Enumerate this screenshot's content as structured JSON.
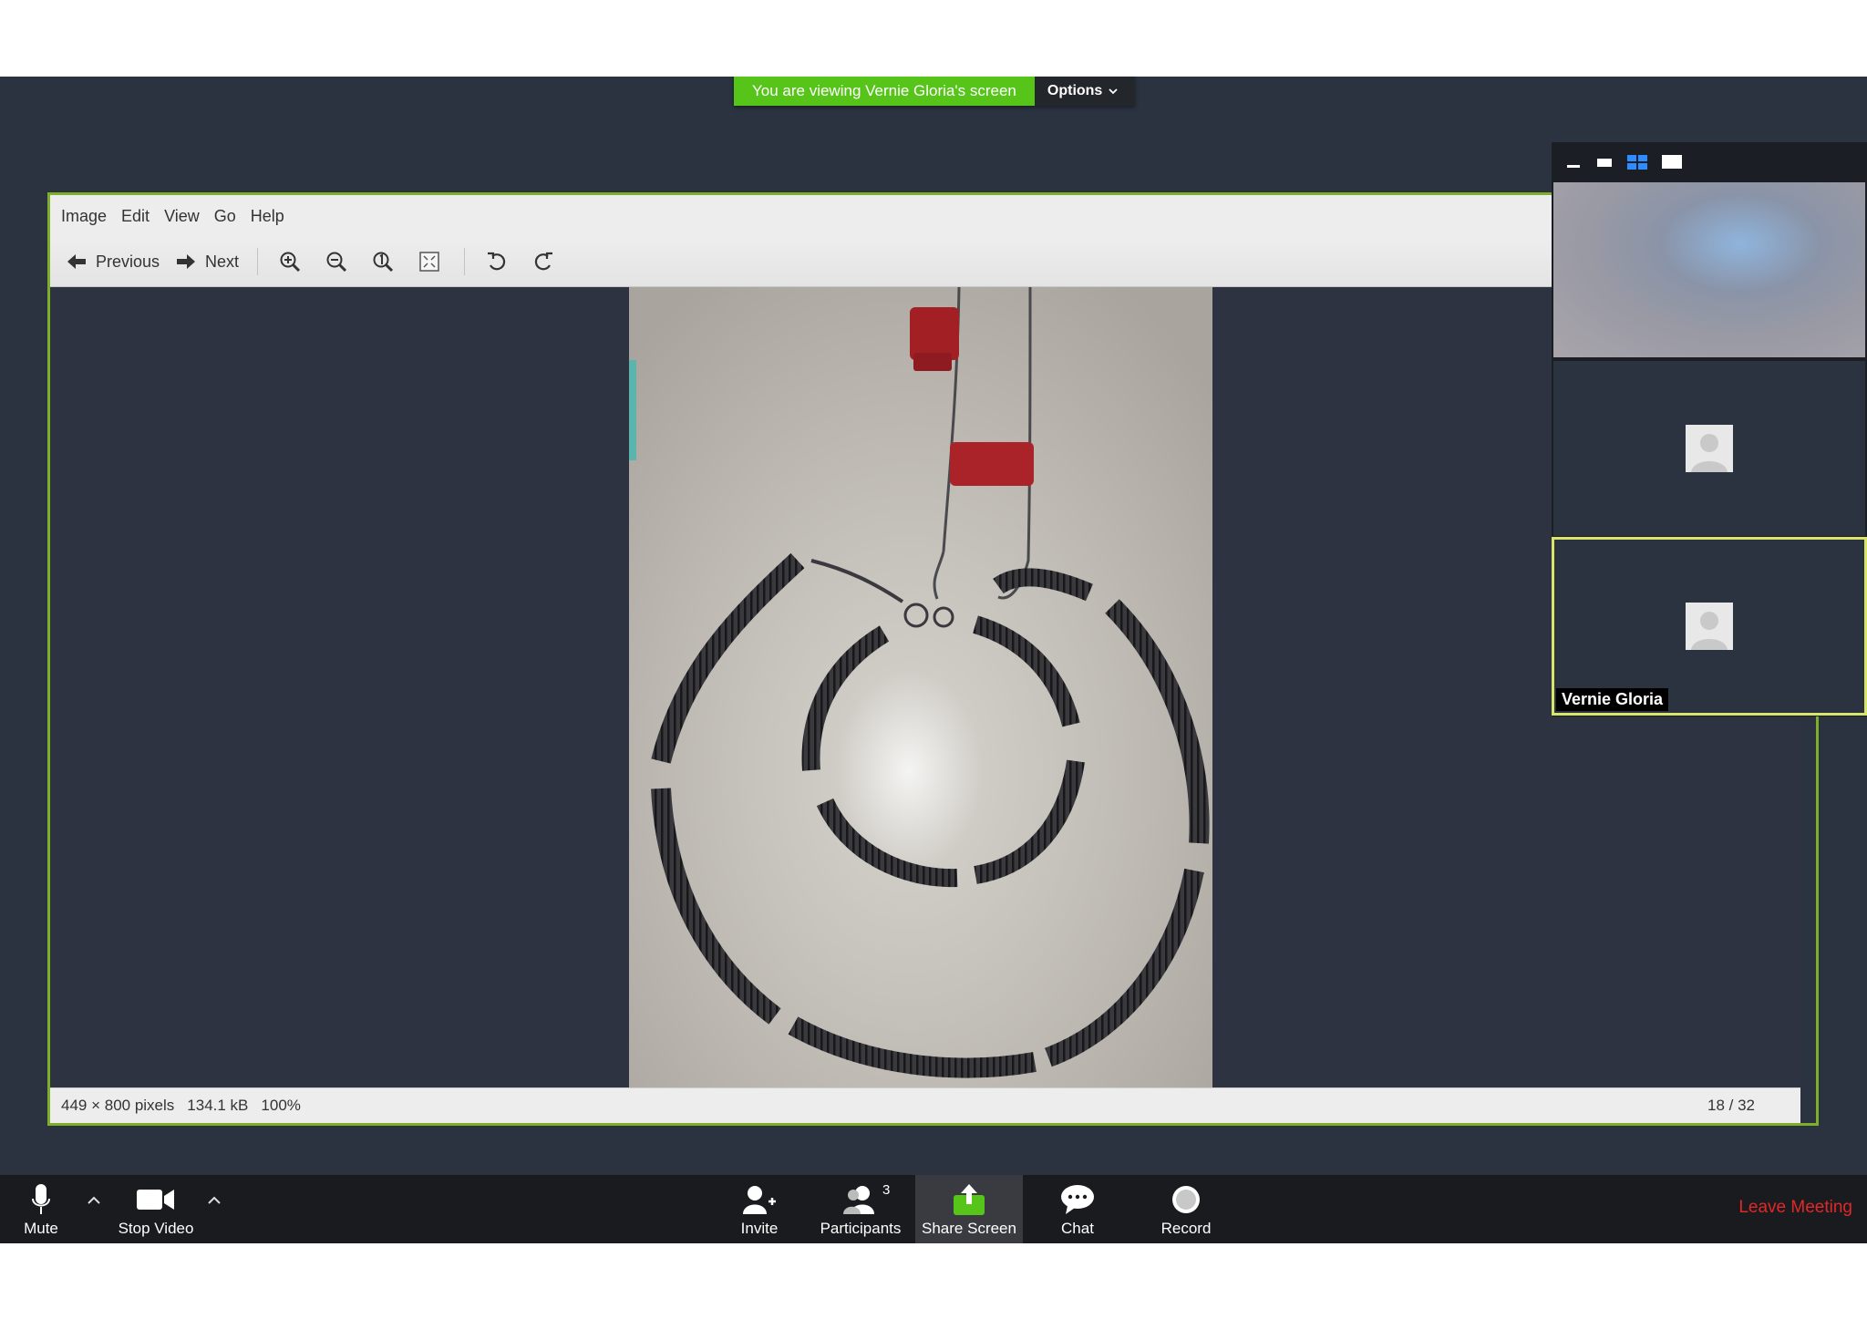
{
  "banner": {
    "message": "You are viewing Vernie Gloria's screen",
    "options_label": "Options"
  },
  "viewer": {
    "menu": [
      "Image",
      "Edit",
      "View",
      "Go",
      "Help"
    ],
    "toolbar": {
      "previous_label": "Previous",
      "next_label": "Next"
    },
    "status": {
      "dimensions": "449 × 800 pixels",
      "size": "134.1 kB",
      "zoom": "100%",
      "position": "18 / 32"
    }
  },
  "gallery": {
    "participant_name": "Vernie Gloria"
  },
  "bottom_bar": {
    "mute_label": "Mute",
    "stop_video_label": "Stop Video",
    "invite_label": "Invite",
    "participants_label": "Participants",
    "participants_count": "3",
    "share_label": "Share Screen",
    "chat_label": "Chat",
    "record_label": "Record",
    "leave_label": "Leave Meeting"
  },
  "colors": {
    "accent_green": "#57c41a",
    "leave_red": "#e02828",
    "active_speaker": "#d8e56a"
  }
}
